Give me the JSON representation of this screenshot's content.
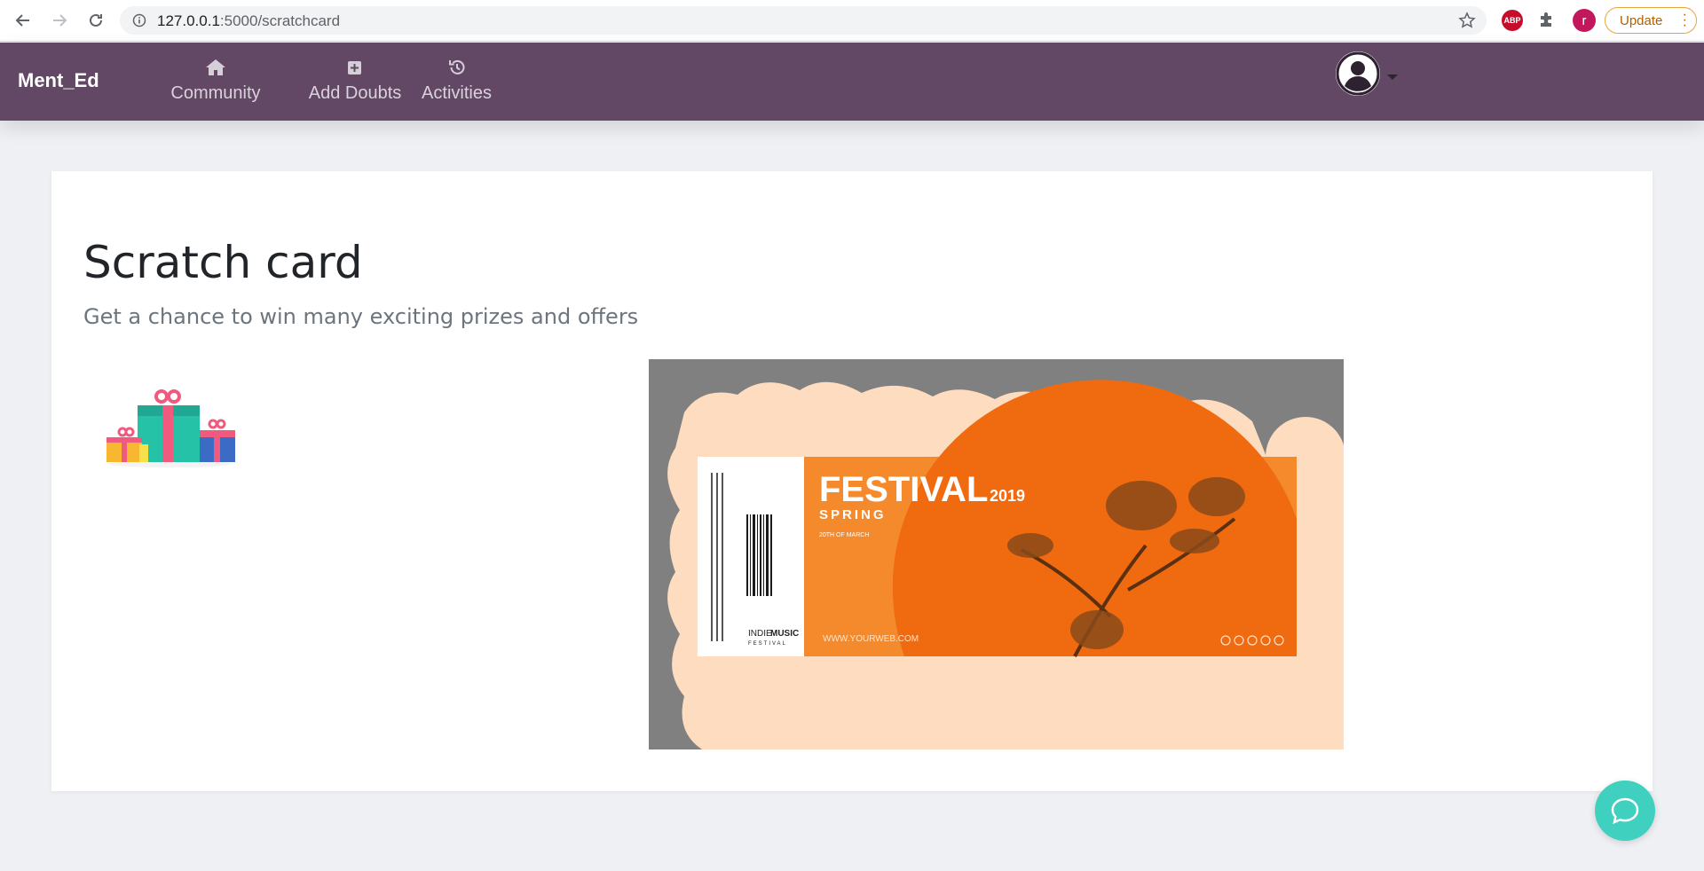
{
  "browser": {
    "url_host": "127.0.0.1",
    "url_path": ":5000/scratchcard",
    "abp_label": "ABP",
    "profile_initial": "r",
    "update_label": "Update"
  },
  "navbar": {
    "brand": "Ment_Ed",
    "items": [
      {
        "label": "Community",
        "icon": "home-icon"
      },
      {
        "label": "Add Doubts",
        "icon": "plus-square-icon"
      },
      {
        "label": "Activities",
        "icon": "history-icon"
      }
    ]
  },
  "page": {
    "title": "Scratch card",
    "subtitle": "Get a chance to win many exciting prizes and offers"
  },
  "ticket": {
    "headline": "FESTIVAL",
    "year": "2019",
    "season": "SPRING",
    "date": "20TH OF MARCH",
    "website": "WWW.YOURWEB.COM",
    "brand_light": "INDIE",
    "brand_bold": "MUSIC",
    "brand_sub": "FESTIVAL"
  },
  "colors": {
    "navbar": "#634866",
    "background": "#eff0f4",
    "scratch_cover": "#808080",
    "scratched": "#fddcbf",
    "ticket_orange": "#f58a2c",
    "chat": "#3fd0c0"
  }
}
